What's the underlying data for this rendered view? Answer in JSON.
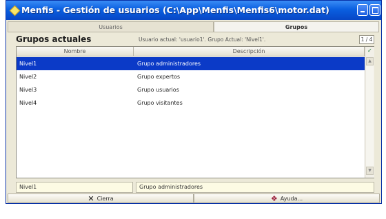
{
  "window": {
    "title": "Menfis - Gestión de usuarios (C:\\App\\Menfis\\Menfis6\\motor.dat)"
  },
  "tabs": [
    {
      "label": "Usuarios",
      "active": false
    },
    {
      "label": "Grupos",
      "active": true
    }
  ],
  "panel": {
    "title": "Grupos actuales",
    "info": "Usuario actual: 'usuario1'. Grupo Actual: 'Nivel1'.",
    "counter": "1 / 4"
  },
  "grid": {
    "columns": [
      "Nombre",
      "Descripción"
    ],
    "rows": [
      {
        "name": "Nivel1",
        "description": "Grupo administradores",
        "selected": true
      },
      {
        "name": "Nivel2",
        "description": "Grupo expertos",
        "selected": false
      },
      {
        "name": "Nivel3",
        "description": "Grupo usuarios",
        "selected": false
      },
      {
        "name": "Nivel4",
        "description": "Grupo visitantes",
        "selected": false
      }
    ]
  },
  "edit": {
    "name": "Nivel1",
    "description": "Grupo administradores"
  },
  "buttons": {
    "close": "Cierra",
    "help": "Ayuda..."
  },
  "icons": {
    "window": "app-diamond-icon",
    "close": "x-icon",
    "help": "help-icon",
    "grid_corner": "check-icon"
  },
  "colors": {
    "titlebar": "#0a5fe0",
    "selection": "#0b3ac7",
    "edit_bg": "#fdfbe4",
    "window_bg": "#ece9d8"
  }
}
